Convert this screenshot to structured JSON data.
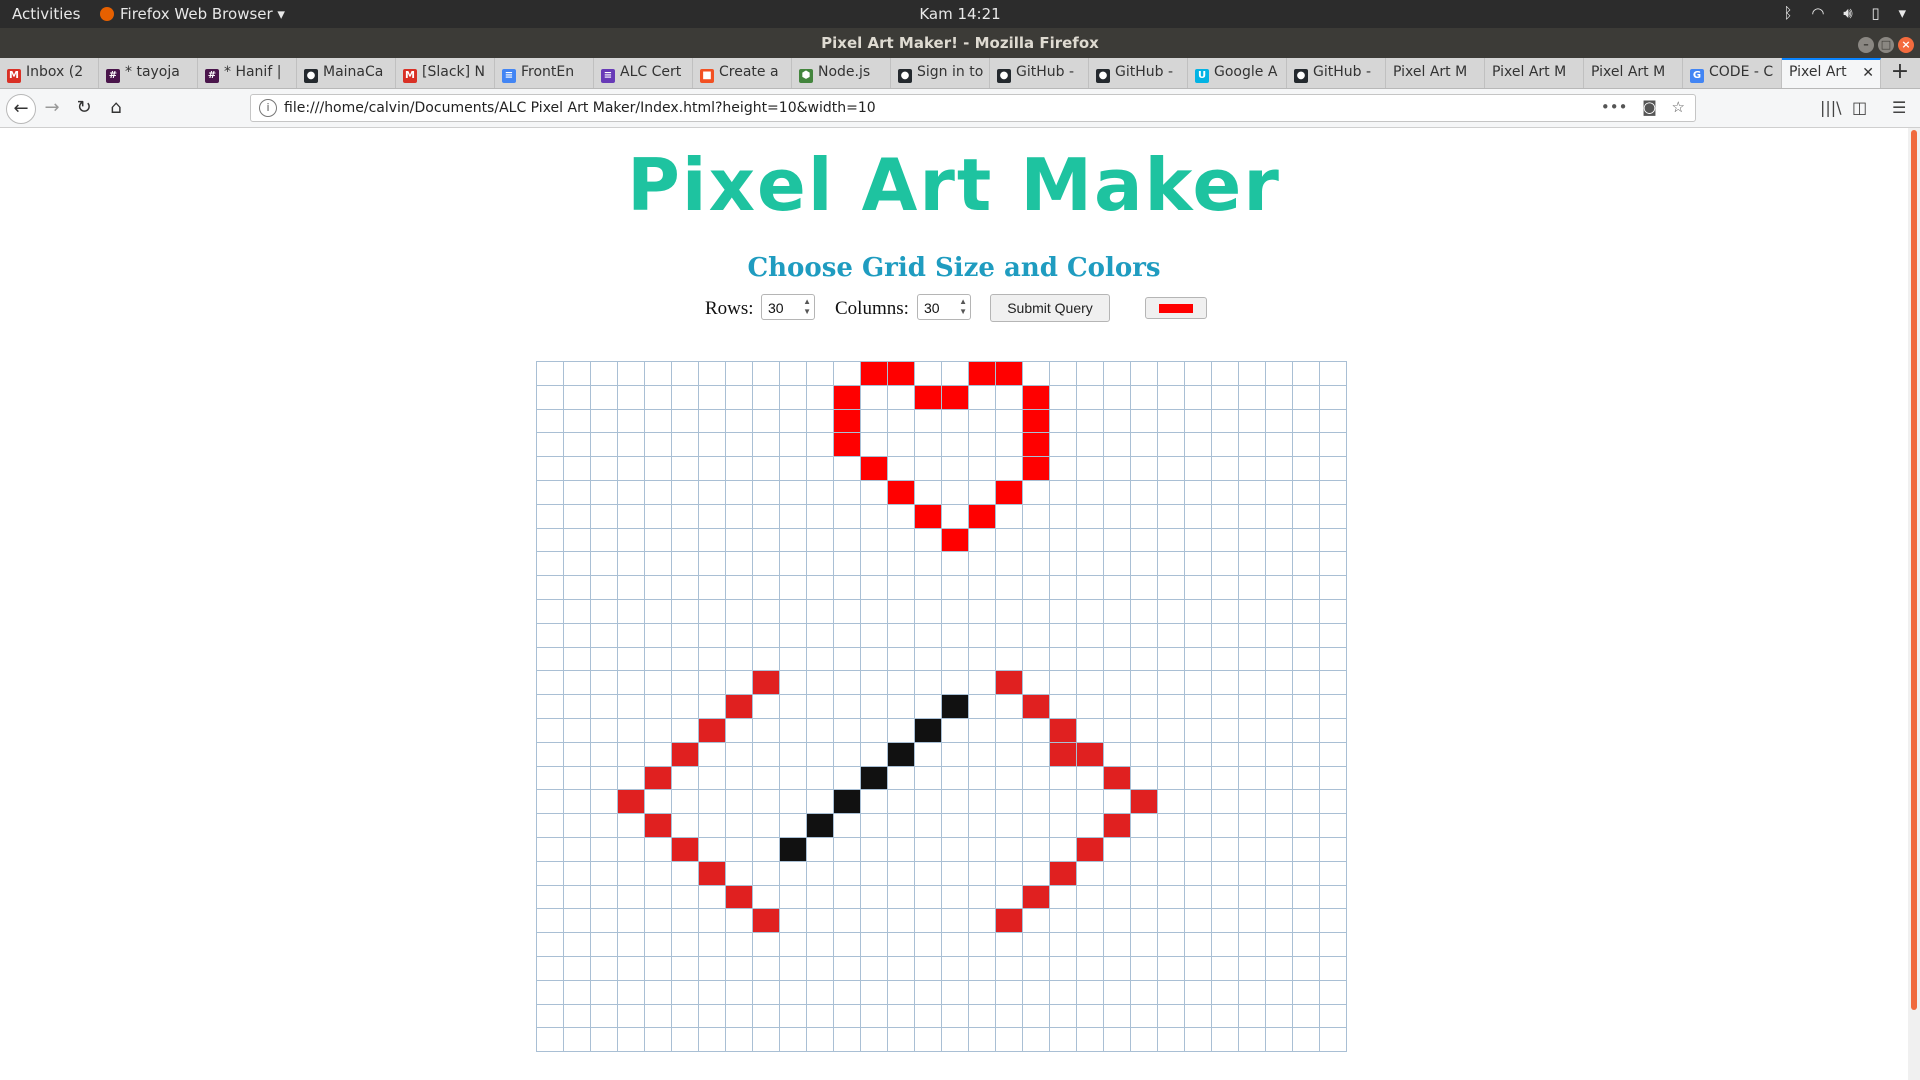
{
  "system": {
    "activities": "Activities",
    "app_menu": "Firefox Web Browser ▾",
    "clock": "Kam 14:21"
  },
  "window": {
    "title": "Pixel Art Maker! - Mozilla Firefox"
  },
  "tabs": [
    {
      "label": "Inbox (2",
      "icon": "gmail-icon",
      "color": "#d93025",
      "glyph": "M"
    },
    {
      "label": "* tayoja",
      "icon": "slack-icon",
      "color": "#4a154b",
      "glyph": "#"
    },
    {
      "label": "* Hanif |",
      "icon": "slack-icon",
      "color": "#4a154b",
      "glyph": "#"
    },
    {
      "label": "MainaCa",
      "icon": "github-icon",
      "color": "#24292e",
      "glyph": "●"
    },
    {
      "label": "[Slack] N",
      "icon": "gmail-icon",
      "color": "#d93025",
      "glyph": "M"
    },
    {
      "label": "FrontEn",
      "icon": "docs-icon",
      "color": "#4285f4",
      "glyph": "≡"
    },
    {
      "label": "ALC Cert",
      "icon": "forms-icon",
      "color": "#673ab7",
      "glyph": "≡"
    },
    {
      "label": "Create a",
      "icon": "microsoft-icon",
      "color": "#f25022",
      "glyph": "■"
    },
    {
      "label": "Node.js",
      "icon": "nodejs-icon",
      "color": "#43853d",
      "glyph": "⬢"
    },
    {
      "label": "Sign in to",
      "icon": "github-icon",
      "color": "#24292e",
      "glyph": "●"
    },
    {
      "label": "GitHub -",
      "icon": "github-icon",
      "color": "#24292e",
      "glyph": "●"
    },
    {
      "label": "GitHub -",
      "icon": "github-icon",
      "color": "#24292e",
      "glyph": "●"
    },
    {
      "label": "Google A",
      "icon": "udacity-icon",
      "color": "#02b3e4",
      "glyph": "U"
    },
    {
      "label": "GitHub -",
      "icon": "github-icon",
      "color": "#24292e",
      "glyph": "●"
    },
    {
      "label": "Pixel Art M",
      "icon": "",
      "color": "",
      "glyph": ""
    },
    {
      "label": "Pixel Art M",
      "icon": "",
      "color": "",
      "glyph": ""
    },
    {
      "label": "Pixel Art M",
      "icon": "",
      "color": "",
      "glyph": ""
    },
    {
      "label": "CODE - C",
      "icon": "google-icon",
      "color": "#4285f4",
      "glyph": "G"
    },
    {
      "label": "Pixel Art",
      "icon": "",
      "color": "",
      "glyph": "",
      "active": true
    }
  ],
  "navbar": {
    "url": "file:///home/calvin/Documents/ALC Pixel Art Maker/Index.html?height=10&width=10"
  },
  "page": {
    "title": "Pixel Art Maker",
    "subtitle": "Choose Grid Size and Colors",
    "rows_label": "Rows:",
    "rows_value": "30",
    "columns_label": "Columns:",
    "columns_value": "30",
    "submit_label": "Submit Query",
    "selected_color": "#ff0000"
  },
  "grid": {
    "visible_rows": 29,
    "visible_cols": 30,
    "colors": {
      "r": "#ff0000",
      "d": "#e02020",
      "k": "#111111"
    },
    "painted": [
      [
        0,
        12,
        "r"
      ],
      [
        0,
        13,
        "r"
      ],
      [
        0,
        16,
        "r"
      ],
      [
        0,
        17,
        "r"
      ],
      [
        1,
        11,
        "r"
      ],
      [
        1,
        14,
        "r"
      ],
      [
        1,
        15,
        "r"
      ],
      [
        1,
        18,
        "r"
      ],
      [
        2,
        11,
        "r"
      ],
      [
        2,
        18,
        "r"
      ],
      [
        3,
        11,
        "r"
      ],
      [
        3,
        18,
        "r"
      ],
      [
        4,
        12,
        "r"
      ],
      [
        4,
        18,
        "r"
      ],
      [
        5,
        13,
        "r"
      ],
      [
        5,
        17,
        "r"
      ],
      [
        6,
        14,
        "r"
      ],
      [
        6,
        16,
        "r"
      ],
      [
        7,
        15,
        "r"
      ],
      [
        13,
        8,
        "d"
      ],
      [
        13,
        17,
        "d"
      ],
      [
        14,
        7,
        "d"
      ],
      [
        14,
        15,
        "k"
      ],
      [
        14,
        18,
        "d"
      ],
      [
        15,
        6,
        "d"
      ],
      [
        15,
        14,
        "k"
      ],
      [
        15,
        19,
        "d"
      ],
      [
        16,
        5,
        "d"
      ],
      [
        16,
        13,
        "k"
      ],
      [
        16,
        19,
        "d"
      ],
      [
        16,
        20,
        "d"
      ],
      [
        17,
        4,
        "d"
      ],
      [
        17,
        12,
        "k"
      ],
      [
        17,
        21,
        "d"
      ],
      [
        18,
        3,
        "d"
      ],
      [
        18,
        11,
        "k"
      ],
      [
        18,
        22,
        "d"
      ],
      [
        19,
        4,
        "d"
      ],
      [
        19,
        10,
        "k"
      ],
      [
        19,
        21,
        "d"
      ],
      [
        20,
        5,
        "d"
      ],
      [
        20,
        9,
        "k"
      ],
      [
        20,
        20,
        "d"
      ],
      [
        21,
        6,
        "d"
      ],
      [
        21,
        19,
        "d"
      ],
      [
        22,
        7,
        "d"
      ],
      [
        22,
        18,
        "d"
      ],
      [
        23,
        8,
        "d"
      ],
      [
        23,
        17,
        "d"
      ]
    ]
  }
}
